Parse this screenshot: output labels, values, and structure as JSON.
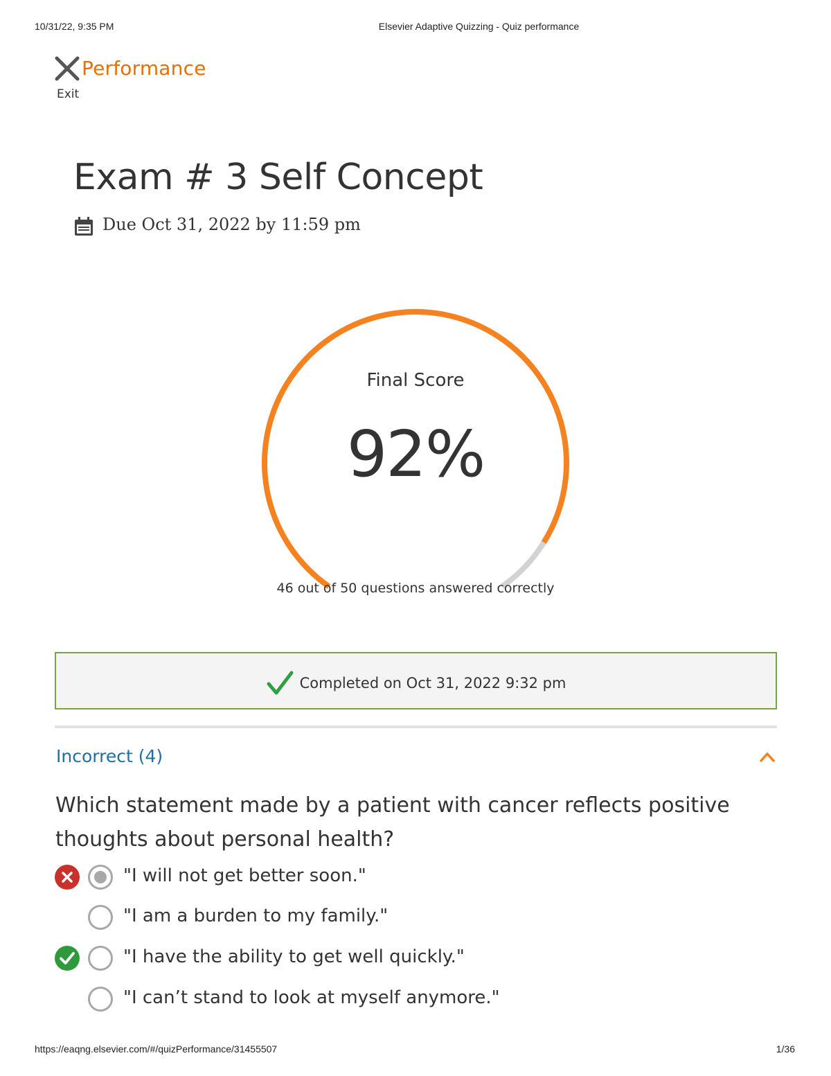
{
  "print_header": {
    "datetime": "10/31/22, 9:35 PM",
    "title": "Elsevier Adaptive Quizzing - Quiz performance"
  },
  "header": {
    "section_title": "Performance",
    "exit_label": "Exit"
  },
  "exam": {
    "title": "Exam # 3 Self Concept",
    "due": "Due Oct 31, 2022 by 11:59 pm"
  },
  "score": {
    "label": "Final Score",
    "percent_text": "92%",
    "percent": 92,
    "correct": 46,
    "total": 50,
    "caption": "46 out of 50 questions answered correctly"
  },
  "completed": {
    "text": "Completed on Oct 31, 2022 9:32 pm"
  },
  "incorrect_section": {
    "label": "Incorrect (4)",
    "expanded": true
  },
  "question": {
    "text": "Which statement made by a patient with cancer reflects positive thoughts about personal health?",
    "answers": [
      {
        "text": "\"I will not get better soon.\"",
        "selected": true,
        "result": "wrong"
      },
      {
        "text": "\"I am a burden to my family.\"",
        "selected": false,
        "result": "none"
      },
      {
        "text": "\"I have the ability to get well quickly.\"",
        "selected": false,
        "result": "correct"
      },
      {
        "text": "\"I can’t stand to look at myself anymore.\"",
        "selected": false,
        "result": "none"
      }
    ]
  },
  "print_footer": {
    "url": "https://eaqng.elsevier.com/#/quizPerformance/31455507",
    "page": "1/36"
  },
  "colors": {
    "accent_orange": "#f58220",
    "performance_orange": "#e86f00",
    "gauge_remainder": "#d3d3d3",
    "completed_border": "#7aa341",
    "check_green": "#2ea043",
    "incorrect_link": "#1f6fa0",
    "wrong_red": "#c8322a",
    "correct_green": "#2e9a3c"
  },
  "icons": {
    "exit": "close-x-icon",
    "due": "calendar-icon",
    "completed": "checkmark-icon",
    "collapse": "chevron-up-icon",
    "wrong": "wrong-answer-icon",
    "correct": "correct-answer-icon"
  }
}
